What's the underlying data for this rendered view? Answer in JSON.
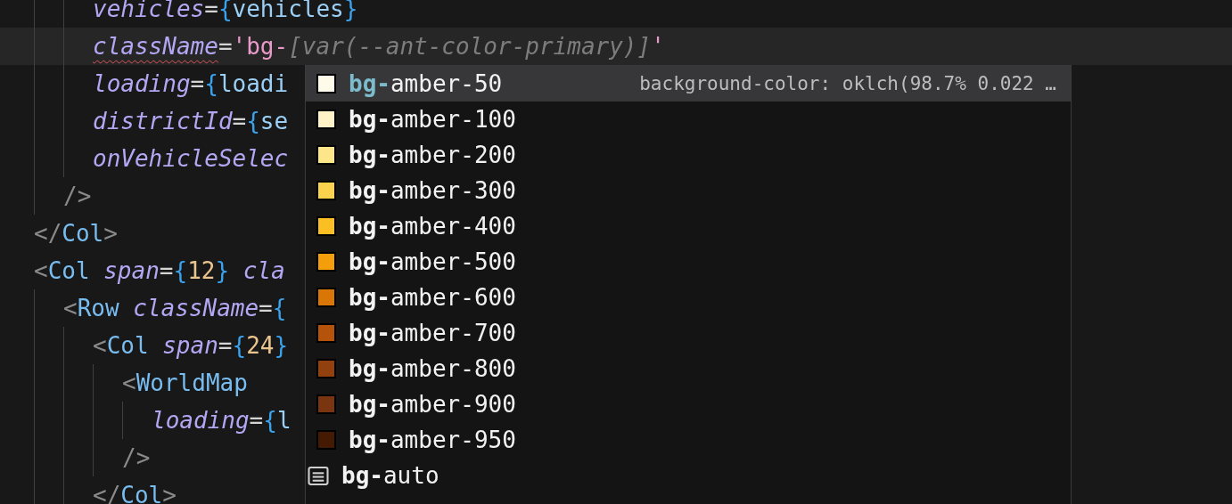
{
  "editor": {
    "lines": [
      {
        "children": [
          {
            "children": [
              {
                "children": [
                  {
                    "current": false,
                    "tokens": [
                      {
                        "kind": "attr",
                        "text": "vehicles"
                      },
                      {
                        "kind": "op",
                        "text": "="
                      },
                      {
                        "kind": "brace",
                        "text": "{"
                      },
                      {
                        "kind": "var",
                        "text": "vehicles"
                      },
                      {
                        "kind": "brace",
                        "text": "}"
                      }
                    ]
                  },
                  {
                    "current": true,
                    "tokens": [
                      {
                        "kind": "attr",
                        "text": "className",
                        "error": true
                      },
                      {
                        "kind": "op",
                        "text": "="
                      },
                      {
                        "kind": "str",
                        "text": "'bg-"
                      },
                      {
                        "kind": "ghost",
                        "text": "[var(--ant-color-primary)]"
                      },
                      {
                        "kind": "str",
                        "text": "'"
                      }
                    ]
                  },
                  {
                    "current": false,
                    "tokens": [
                      {
                        "kind": "attr",
                        "text": "loading"
                      },
                      {
                        "kind": "op",
                        "text": "="
                      },
                      {
                        "kind": "brace",
                        "text": "{"
                      },
                      {
                        "kind": "var",
                        "text": "loadi"
                      }
                    ]
                  },
                  {
                    "current": false,
                    "tokens": [
                      {
                        "kind": "attr",
                        "text": "districtId"
                      },
                      {
                        "kind": "op",
                        "text": "="
                      },
                      {
                        "kind": "brace",
                        "text": "{"
                      },
                      {
                        "kind": "var",
                        "text": "se"
                      }
                    ]
                  },
                  {
                    "current": false,
                    "tokens": [
                      {
                        "kind": "attr",
                        "text": "onVehicleSelec"
                      }
                    ]
                  }
                ]
              },
              {
                "current": false,
                "tokens": [
                  {
                    "kind": "punct",
                    "text": "/>"
                  }
                ]
              }
            ]
          },
          {
            "current": false,
            "tokens": [
              {
                "kind": "punct",
                "text": "</"
              },
              {
                "kind": "tag",
                "text": "Col"
              },
              {
                "kind": "punct",
                "text": ">"
              }
            ]
          },
          {
            "current": false,
            "tokens": [
              {
                "kind": "punct",
                "text": "<"
              },
              {
                "kind": "tag",
                "text": "Col"
              },
              {
                "kind": "attr",
                "text": "span"
              },
              {
                "kind": "op",
                "text": "="
              },
              {
                "kind": "brace",
                "text": "{"
              },
              {
                "kind": "num",
                "text": "12"
              },
              {
                "kind": "brace",
                "text": "}"
              },
              {
                "kind": "attr",
                "text": "cla"
              }
            ],
            "children": [
              {
                "current": false,
                "tokens": [
                  {
                    "kind": "punct",
                    "text": "<"
                  },
                  {
                    "kind": "tag",
                    "text": "Row"
                  },
                  {
                    "kind": "attr",
                    "text": "className"
                  },
                  {
                    "kind": "op",
                    "text": "="
                  },
                  {
                    "kind": "brace",
                    "text": "{"
                  }
                ],
                "children": [
                  {
                    "current": false,
                    "tokens": [
                      {
                        "kind": "punct",
                        "text": "<"
                      },
                      {
                        "kind": "tag",
                        "text": "Col"
                      },
                      {
                        "kind": "attr",
                        "text": "span"
                      },
                      {
                        "kind": "op",
                        "text": "="
                      },
                      {
                        "kind": "brace",
                        "text": "{"
                      },
                      {
                        "kind": "num",
                        "text": "24"
                      },
                      {
                        "kind": "brace",
                        "text": "}"
                      }
                    ],
                    "children": [
                      {
                        "current": false,
                        "tokens": [
                          {
                            "kind": "punct",
                            "text": "<"
                          },
                          {
                            "kind": "tag",
                            "text": "WorldMap"
                          }
                        ],
                        "children": [
                          {
                            "current": false,
                            "tokens": [
                              {
                                "kind": "attr",
                                "text": "loading"
                              },
                              {
                                "kind": "op",
                                "text": "="
                              },
                              {
                                "kind": "brace",
                                "text": "{"
                              },
                              {
                                "kind": "var",
                                "text": "l"
                              }
                            ]
                          }
                        ]
                      },
                      {
                        "current": false,
                        "tokens": [
                          {
                            "kind": "punct",
                            "text": "/>"
                          }
                        ]
                      }
                    ]
                  },
                  {
                    "current": false,
                    "tokens": [
                      {
                        "kind": "punct",
                        "text": "</"
                      },
                      {
                        "kind": "tag",
                        "text": "Col"
                      },
                      {
                        "kind": "punct",
                        "text": ">"
                      }
                    ]
                  }
                ]
              }
            ]
          }
        ]
      }
    ]
  },
  "suggestions": {
    "items": [
      {
        "kind": "color",
        "match": "bg-",
        "rest": "amber-50",
        "color": "#fffbeb",
        "selected": true,
        "detail": "background-color: oklch(98.7% 0.022 …"
      },
      {
        "kind": "color",
        "match": "bg-",
        "rest": "amber-100",
        "color": "#fef3c7",
        "selected": false
      },
      {
        "kind": "color",
        "match": "bg-",
        "rest": "amber-200",
        "color": "#fde68a",
        "selected": false
      },
      {
        "kind": "color",
        "match": "bg-",
        "rest": "amber-300",
        "color": "#fcd34d",
        "selected": false
      },
      {
        "kind": "color",
        "match": "bg-",
        "rest": "amber-400",
        "color": "#fbbf24",
        "selected": false
      },
      {
        "kind": "color",
        "match": "bg-",
        "rest": "amber-500",
        "color": "#f59e0b",
        "selected": false
      },
      {
        "kind": "color",
        "match": "bg-",
        "rest": "amber-600",
        "color": "#d97706",
        "selected": false
      },
      {
        "kind": "color",
        "match": "bg-",
        "rest": "amber-700",
        "color": "#b45309",
        "selected": false
      },
      {
        "kind": "color",
        "match": "bg-",
        "rest": "amber-800",
        "color": "#92400e",
        "selected": false
      },
      {
        "kind": "color",
        "match": "bg-",
        "rest": "amber-900",
        "color": "#78350f",
        "selected": false
      },
      {
        "kind": "color",
        "match": "bg-",
        "rest": "amber-950",
        "color": "#451a03",
        "selected": false
      },
      {
        "kind": "value",
        "match": "bg-",
        "rest": "auto",
        "selected": false
      }
    ]
  }
}
